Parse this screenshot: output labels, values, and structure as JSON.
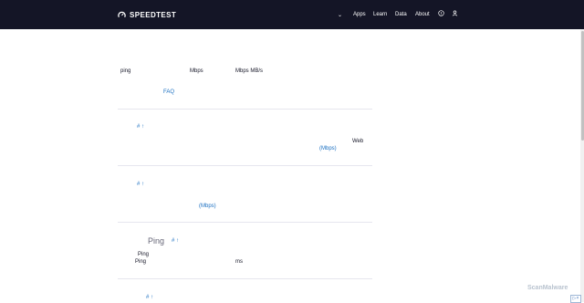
{
  "header": {
    "logo_text": "SPEEDTEST",
    "nav": {
      "chevron": "⌄",
      "apps": "Apps",
      "learn": "Learn",
      "data": "Data",
      "about": "About"
    }
  },
  "section1": {
    "ping_label": "ping",
    "mbps_label": "Mbps",
    "mbps_mbs_label": "Mbps  MB/s",
    "faq_link": "FAQ"
  },
  "section2": {
    "hash_arrow": "# ↑",
    "web_label": "Web",
    "mbps_link": "(Mbps)"
  },
  "section3": {
    "hash_arrow": "# ↑",
    "mbps_link": "(Mbps)"
  },
  "section4": {
    "ping_heading": "Ping",
    "hash_arrow": "# ↑",
    "ping_small_1": "Ping",
    "ping_small_2": "Ping",
    "ms_label": "ms"
  },
  "section5": {
    "hash_arrow": "# ↑"
  },
  "watermark": "ScanMalware",
  "ad_badge": "▷×"
}
